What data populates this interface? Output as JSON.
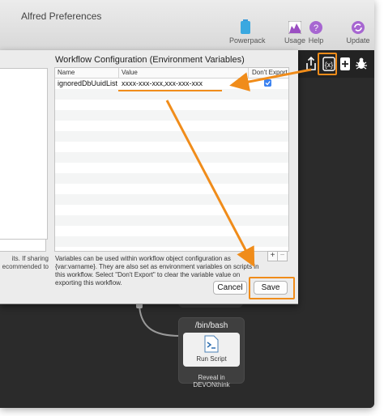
{
  "window": {
    "title": "Alfred Preferences"
  },
  "toolbar": {
    "powerpack_label": "Powerpack",
    "usage_label": "Usage",
    "help_label": "Help",
    "update_label": "Update"
  },
  "sheet": {
    "title": "Workflow Configuration (Environment Variables)",
    "columns": {
      "name": "Name",
      "value": "Value",
      "dont_export": "Don't Export"
    },
    "rows": [
      {
        "name": "ignoredDbUuidList",
        "value": "xxxx-xxx-xxx,xxx-xxx-xxx",
        "dont_export": true
      }
    ],
    "help_text": "Variables can be used within workflow object configuration as {var:varname}. They are also set as environment variables on scripts in this workflow. Select \"Don't Export\" to clear the variable value on exporting this workflow.",
    "plus_label": "+",
    "minus_label": "−",
    "cancel_label": "Cancel",
    "save_label": "Save"
  },
  "left_panel": {
    "fragment_text": "its. If sharing ecommended to"
  },
  "node": {
    "title": "/bin/bash",
    "subtitle": "Run Script",
    "caption": "Reveal in DEVONthink"
  },
  "colors": {
    "accent_highlight": "#f08c1a",
    "checkbox": "#3b82f0",
    "canvas": "#2b2b2b"
  }
}
